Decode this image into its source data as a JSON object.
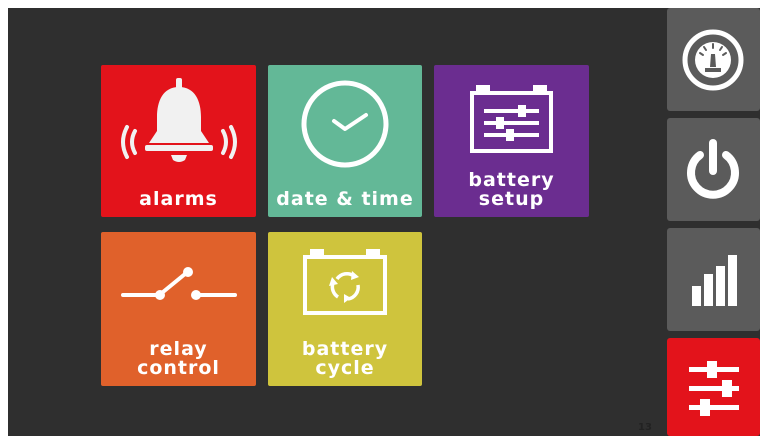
{
  "tiles": {
    "alarms": {
      "label": "alarms",
      "icon": "bell-icon",
      "color": "#e3131b"
    },
    "date_time": {
      "label": "date & time",
      "icon": "clock-icon",
      "color": "#63b897"
    },
    "battery_setup": {
      "label": "battery\nsetup",
      "icon": "battery-setup-icon",
      "color": "#6b2d90"
    },
    "relay_control": {
      "label": "relay\ncontrol",
      "icon": "relay-switch-icon",
      "color": "#e0612b"
    },
    "battery_cycle": {
      "label": "battery\ncycle",
      "icon": "battery-cycle-icon",
      "color": "#cfc43d"
    }
  },
  "sidebar": {
    "items": [
      {
        "icon": "gauge-icon",
        "color": "#5b5b5b",
        "active": false
      },
      {
        "icon": "power-icon",
        "color": "#5b5b5b",
        "active": false
      },
      {
        "icon": "bar-chart-icon",
        "color": "#5b5b5b",
        "active": false
      },
      {
        "icon": "settings-sliders-icon",
        "color": "#e3131b",
        "active": true
      }
    ]
  },
  "page_number": "13"
}
